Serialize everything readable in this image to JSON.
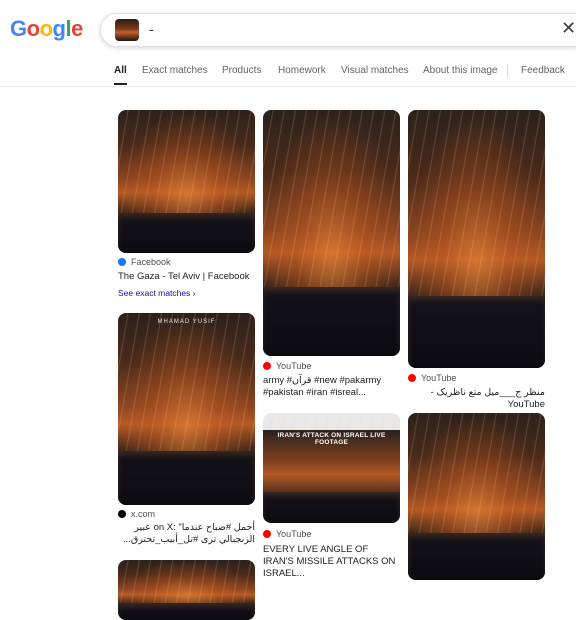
{
  "logo": {
    "letters": [
      "G",
      "o",
      "o",
      "g",
      "l",
      "e"
    ],
    "colors": [
      "#4285F4",
      "#EA4335",
      "#FBBC05",
      "#4285F4",
      "#34A853",
      "#EA4335"
    ]
  },
  "search": {
    "query": "-",
    "close_icon": "close-icon"
  },
  "tabs": [
    {
      "label": "All",
      "active": true
    },
    {
      "label": "Exact matches"
    },
    {
      "label": "Products"
    },
    {
      "label": "Homework"
    },
    {
      "label": "Visual matches"
    },
    {
      "label": "About this image"
    },
    {
      "label": "Feedback"
    }
  ],
  "results": [
    {
      "source": "Facebook",
      "source_color": "#1877F2",
      "title": "The Gaza - Tel Aviv | Facebook",
      "exact_label": "See exact matches ›"
    },
    {
      "source": "YouTube",
      "source_color": "#FF0000",
      "title": "army #قرآن #new #pakarmy #pakistan #iran #isreal..."
    },
    {
      "source": "YouTube",
      "source_color": "#FF0000",
      "title": "منظر ج___میل متع ناظریک - YouTube"
    },
    {
      "source": "x.com",
      "source_color": "#000000",
      "title": "أجمل #صباح عندما\" :on X عبير الزنجبالي ترى #تل_أبيب_تحترق..."
    },
    {
      "source": "YouTube",
      "source_color": "#FF0000",
      "title": "EVERY LIVE ANGLE OF IRAN'S MISSILE ATTACKS ON ISRAEL..."
    }
  ],
  "overlays": {
    "watermark": "MHAMAD YUSIF",
    "banner": "IRAN'S ATTACK ON ISRAEL LIVE FOOTAGE"
  }
}
